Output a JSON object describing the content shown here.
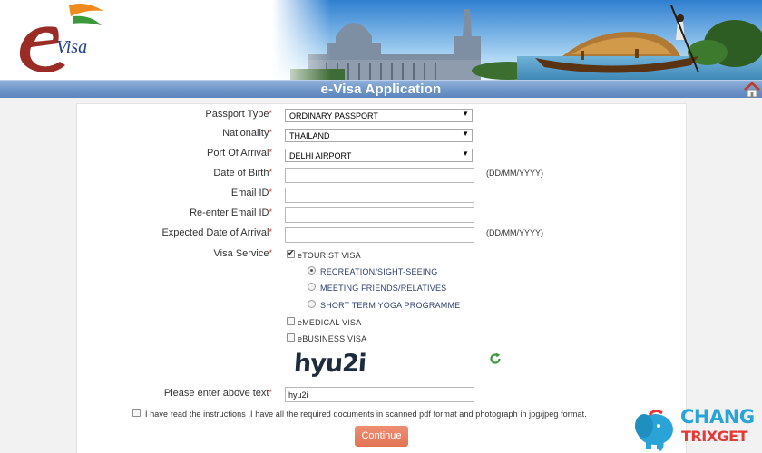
{
  "header": {
    "logo_text": "Visa",
    "title": "e-Visa Application"
  },
  "form": {
    "passport_type": {
      "label": "Passport Type",
      "value": "ORDINARY PASSPORT"
    },
    "nationality": {
      "label": "Nationality",
      "value": "THAILAND"
    },
    "port_of_arrival": {
      "label": "Port Of Arrival",
      "value": "DELHI AIRPORT"
    },
    "date_of_birth": {
      "label": "Date of Birth",
      "value": "",
      "hint": "(DD/MM/YYYY)"
    },
    "email": {
      "label": "Email ID",
      "value": ""
    },
    "reenter_email": {
      "label": "Re-enter Email ID",
      "value": ""
    },
    "expected_arrival": {
      "label": "Expected Date of Arrival",
      "value": "",
      "hint": "(DD/MM/YYYY)"
    },
    "visa_service": {
      "label": "Visa Service",
      "etourist": {
        "label": "eTOURIST VISA",
        "checked": true
      },
      "purposes": [
        {
          "label": "RECREATION/SIGHT-SEEING",
          "selected": true
        },
        {
          "label": "MEETING FRIENDS/RELATIVES",
          "selected": false
        },
        {
          "label": "SHORT TERM YOGA PROGRAMME",
          "selected": false
        }
      ],
      "emedical": {
        "label": "eMEDICAL VISA",
        "checked": false
      },
      "ebusiness": {
        "label": "eBUSINESS VISA",
        "checked": false
      }
    },
    "captcha": {
      "image_text": "hyu2i",
      "label": "Please enter above text",
      "value": "hyu2i"
    },
    "terms": {
      "text": "I have read the instructions ,I have all the required documents in scanned pdf format and photograph in jpg/jpeg format.",
      "checked": false
    },
    "continue_label": "Continue"
  },
  "watermark": {
    "line1": "CHANG",
    "line2": "TRIXGET"
  },
  "colors": {
    "titlebar": "#6f95c7",
    "required": "#d9342b",
    "continue": "#e27456",
    "refresh": "#3a9a3a"
  }
}
